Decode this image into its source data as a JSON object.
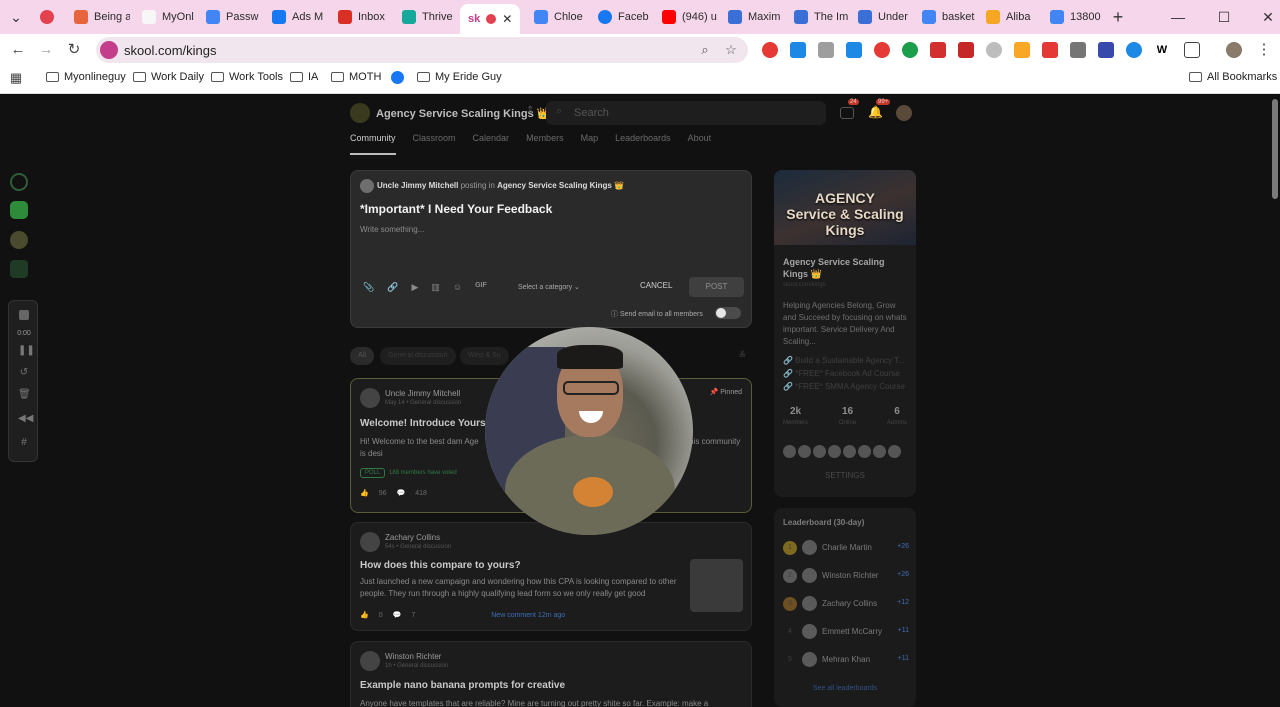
{
  "browser": {
    "tabs": [
      {
        "label": "Being a",
        "color": "#e8643c"
      },
      {
        "label": "MyOnl",
        "color": "#f0f0f0"
      },
      {
        "label": "Passw",
        "color": "#4285f4"
      },
      {
        "label": "Ads M",
        "color": "#1877f2"
      },
      {
        "label": "Inbox",
        "color": "#d93025"
      },
      {
        "label": "Thrive",
        "color": "#16a89a"
      },
      {
        "label": "sk",
        "color": "#c33d8a",
        "active": true
      },
      {
        "label": "Chloe",
        "color": "#4285f4"
      },
      {
        "label": "Faceb",
        "color": "#1877f2"
      },
      {
        "label": "(946) u",
        "color": "#ff0000"
      },
      {
        "label": "Maxim",
        "color": "#3b6fd8"
      },
      {
        "label": "The Im",
        "color": "#3b6fd8"
      },
      {
        "label": "Under",
        "color": "#3b6fd8"
      },
      {
        "label": "basket",
        "color": "#4285f4"
      },
      {
        "label": "Aliba",
        "color": "#f5a623"
      },
      {
        "label": "13800",
        "color": "#4285f4"
      }
    ],
    "url": "skool.com/kings",
    "bookmarks": [
      "Myonlineguy",
      "Work Daily",
      "Work Tools",
      "IA",
      "MOTH",
      "",
      "My Eride Guy"
    ],
    "all_bookmarks": "All Bookmarks",
    "recorder_time": "0:00"
  },
  "skool": {
    "community_name": "Agency Service Scaling Kings 👑",
    "search_placeholder": "Search",
    "nav": [
      "Community",
      "Classroom",
      "Calendar",
      "Members",
      "Map",
      "Leaderboards",
      "About"
    ],
    "badges": {
      "chat": "24",
      "notifications": "99+"
    }
  },
  "composer": {
    "user": "Uncle Jimmy Mitchell",
    "posting_in": "posting in",
    "group": "Agency Service Scaling Kings 👑",
    "title": "*Important* I Need Your Feedback",
    "placeholder": "Write something...",
    "gif": "GIF",
    "category": "Select a category",
    "cancel": "CANCEL",
    "post": "POST",
    "email_label": "Send email to all members"
  },
  "filters": {
    "all": "All",
    "general": "General discussion",
    "wins": "Wins & Su"
  },
  "posts": [
    {
      "author": "Uncle Jimmy Mitchell",
      "meta": "May 14 • General discussion",
      "pinned": "Pinned",
      "title": "Welcome! Introduce Yours",
      "body": "Hi! Welcome to the best dam Age                                                        Because of you guys). This community is desi                                                        AND scale",
      "poll": "POLL",
      "poll_votes": "188 members have voted",
      "likes": "96",
      "comments": "418"
    },
    {
      "author": "Zachary Collins",
      "meta": "54s • General discussion",
      "title": "How does this compare to yours?",
      "body": "Just launched a new campaign and wondering how this CPA is looking compared to other people. They run through a highly qualifying lead form so we only really get good",
      "likes": "0",
      "comments": "7",
      "new_comment": "New comment 12m ago"
    },
    {
      "author": "Winston Richter",
      "meta": "1h • General discussion",
      "title": "Example nano banana prompts for creative",
      "body": "Anyone have templates that are reliable? Mine are turning out pretty shite so far. Example: make a"
    }
  ],
  "sidebar": {
    "banner_text": "AGENCY\nService & Scaling\nKings",
    "name": "Agency Service Scaling Kings 👑",
    "url": "skool.com/kings",
    "description": "Helping Agencies Belong, Grow and Succeed by focusing on whats important. Service Delivery And Scaling...",
    "links": [
      "🔗 Build a Sustainable Agency T...",
      "🔗 *FREE* Facebook Ad Course",
      "🔗 *FREE* SMMA Agency Course"
    ],
    "stats": [
      {
        "value": "2k",
        "label": "Members"
      },
      {
        "value": "16",
        "label": "Online"
      },
      {
        "value": "6",
        "label": "Admins"
      }
    ],
    "settings": "SETTINGS"
  },
  "leaderboard": {
    "title": "Leaderboard (30-day)",
    "rows": [
      {
        "rank": "1",
        "name": "Charlie Martin",
        "points": "+26"
      },
      {
        "rank": "2",
        "name": "Winston Richter",
        "points": "+26"
      },
      {
        "rank": "3",
        "name": "Zachary Collins",
        "points": "+12"
      },
      {
        "rank": "4",
        "name": "Emmett McCarry",
        "points": "+11"
      },
      {
        "rank": "5",
        "name": "Mehran Khan",
        "points": "+11"
      }
    ],
    "see_all": "See all leaderboards"
  }
}
